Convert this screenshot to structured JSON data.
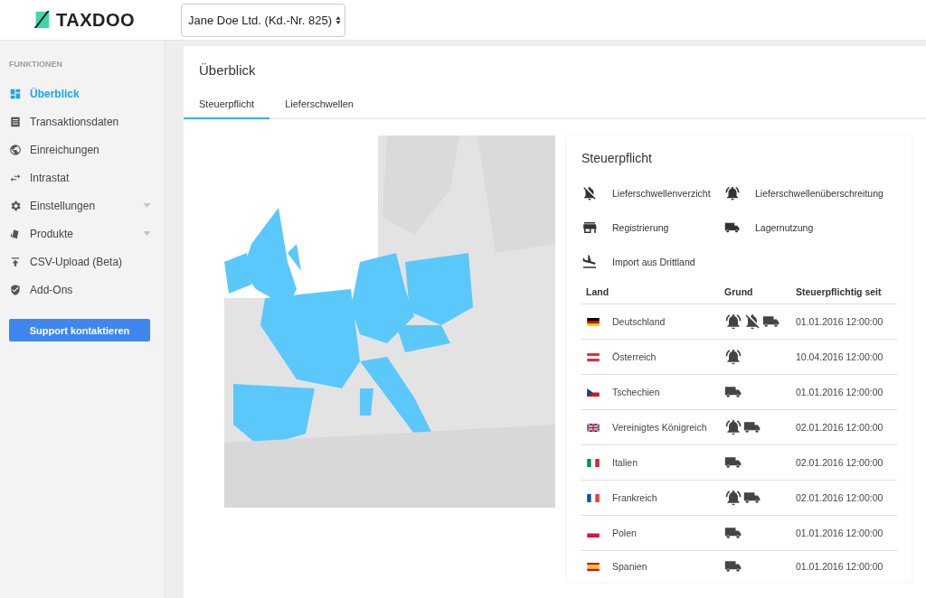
{
  "header": {
    "logo": "TAXDOO",
    "client_select": "Jane Doe Ltd. (Kd.-Nr. 825)"
  },
  "sidebar": {
    "heading": "FUNKTIONEN",
    "items": [
      {
        "label": "Überblick",
        "selected": true,
        "expandable": false
      },
      {
        "label": "Transaktionsdaten",
        "selected": false,
        "expandable": false
      },
      {
        "label": "Einreichungen",
        "selected": false,
        "expandable": false
      },
      {
        "label": "Intrastat",
        "selected": false,
        "expandable": false
      },
      {
        "label": "Einstellungen",
        "selected": false,
        "expandable": true
      },
      {
        "label": "Produkte",
        "selected": false,
        "expandable": true
      },
      {
        "label": "CSV-Upload (Beta)",
        "selected": false,
        "expandable": false
      },
      {
        "label": "Add-Ons",
        "selected": false,
        "expandable": false
      }
    ],
    "button": "Support kontaktieren"
  },
  "page": {
    "title": "Überblick",
    "tabs": [
      {
        "label": "Steuerpflicht",
        "selected": true
      },
      {
        "label": "Lieferschwellen",
        "selected": false
      }
    ]
  },
  "panel": {
    "title": "Steuerpflicht",
    "legend": [
      {
        "kind": "waiver",
        "label": "Lieferschwellenverzicht"
      },
      {
        "kind": "alarm",
        "label": "Lieferschwellenüberschreitung"
      },
      {
        "kind": "store",
        "label": "Registrierung"
      },
      {
        "kind": "truck",
        "label": "Lagernutzung"
      },
      {
        "kind": "plane",
        "label": "Import aus Drittland"
      }
    ],
    "table": {
      "columns": [
        "Land",
        "Grund",
        "Steuerpflichtig seit"
      ],
      "rows": [
        {
          "country": "Deutschland",
          "threshold_exceeded": true,
          "threshold_waiver": true,
          "warehouse": true,
          "since": "01.01.2016 12:00:00"
        },
        {
          "country": "Österreich",
          "threshold_exceeded": true,
          "threshold_waiver": false,
          "warehouse": false,
          "since": "10.04.2016 12:00:00"
        },
        {
          "country": "Tschechien",
          "threshold_exceeded": false,
          "threshold_waiver": false,
          "warehouse": true,
          "since": "01.01.2016 12:00:00"
        },
        {
          "country": "Vereinigtes Königreich",
          "threshold_exceeded": true,
          "threshold_waiver": false,
          "warehouse": true,
          "since": "02.01.2016 12:00:00"
        },
        {
          "country": "Italien",
          "threshold_exceeded": false,
          "threshold_waiver": false,
          "warehouse": true,
          "since": "02.01.2016 12:00:00"
        },
        {
          "country": "Frankreich",
          "threshold_exceeded": true,
          "threshold_waiver": false,
          "warehouse": true,
          "since": "02.01.2016 12:00:00"
        },
        {
          "country": "Polen",
          "threshold_exceeded": false,
          "threshold_waiver": false,
          "warehouse": true,
          "since": "01.01.2016 12:00:00"
        },
        {
          "country": "Spanien",
          "threshold_exceeded": false,
          "threshold_waiver": false,
          "warehouse": true,
          "since": "01.01.2016 12:00:00"
        }
      ]
    }
  }
}
